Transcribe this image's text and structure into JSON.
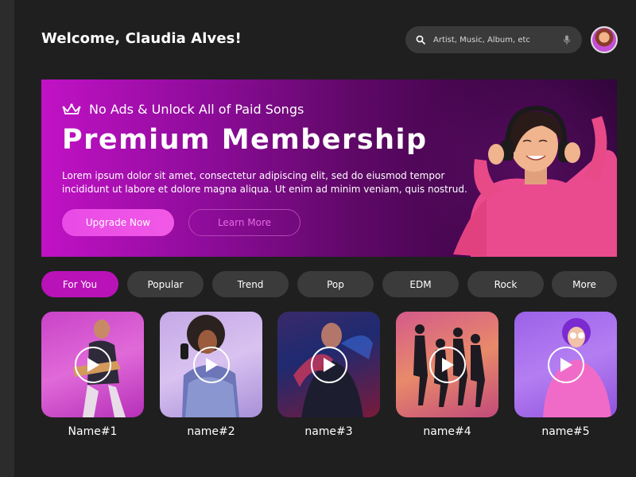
{
  "header": {
    "welcome": "Welcome, Claudia Alves!",
    "search_placeholder": "Artist, Music, Album, etc",
    "search_icon": "search-icon",
    "mic_icon": "microphone-icon"
  },
  "banner": {
    "promo": "No Ads & Unlock All of Paid Songs",
    "title": "Premium Membership",
    "description_line1": "Lorem ipsum dolor sit amet, consectetur adipiscing elit, sed do eiusmod tempor",
    "description_line2": "incididunt ut labore et dolore magna aliqua. Ut enim ad minim veniam, quis nostrud.",
    "upgrade_label": "Upgrade Now",
    "learn_label": "Learn More",
    "crown_icon": "crown-icon"
  },
  "tabs": [
    {
      "label": "For You",
      "active": true
    },
    {
      "label": "Popular",
      "active": false
    },
    {
      "label": "Trend",
      "active": false
    },
    {
      "label": "Pop",
      "active": false
    },
    {
      "label": "EDM",
      "active": false
    },
    {
      "label": "Rock",
      "active": false
    },
    {
      "label": "More",
      "active": false
    }
  ],
  "cards": [
    {
      "label": "Name#1"
    },
    {
      "label": "name#2"
    },
    {
      "label": "name#3"
    },
    {
      "label": "name#4"
    },
    {
      "label": "name#5"
    }
  ],
  "colors": {
    "accent": "#b912b8",
    "background": "#1f1f1f",
    "chip": "#3b3b3b"
  }
}
